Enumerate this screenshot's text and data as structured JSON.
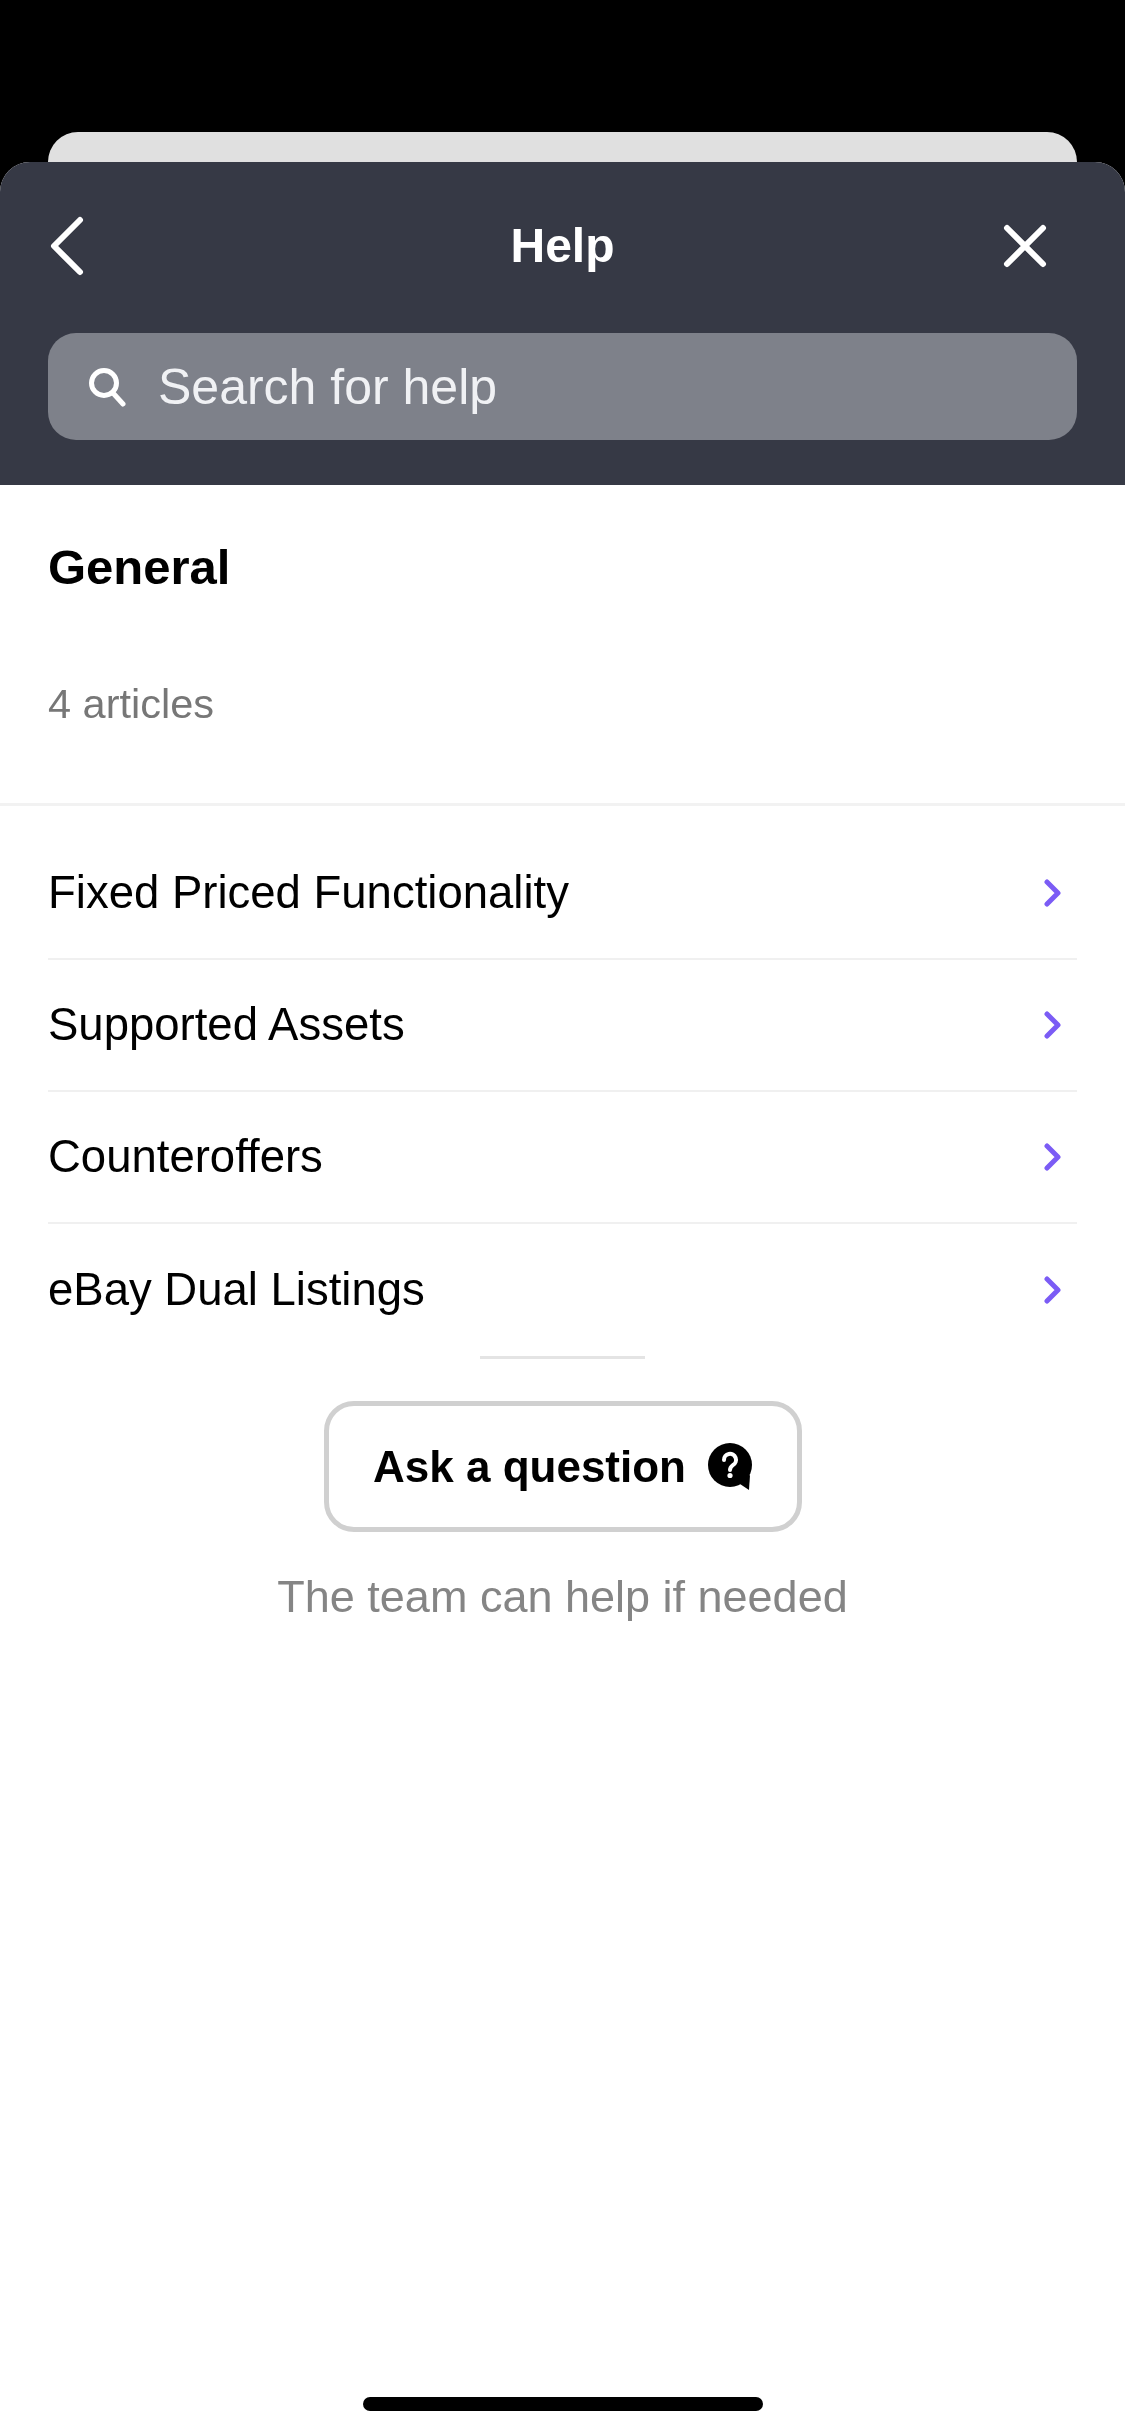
{
  "header": {
    "title": "Help",
    "search": {
      "placeholder": "Search for help"
    }
  },
  "section": {
    "title": "General",
    "article_count": "4 articles"
  },
  "articles": [
    {
      "title": "Fixed Priced Functionality"
    },
    {
      "title": "Supported Assets"
    },
    {
      "title": "Counteroffers"
    },
    {
      "title": "eBay Dual Listings"
    }
  ],
  "ask_button": {
    "label": "Ask a question"
  },
  "note": "The team can help if needed"
}
